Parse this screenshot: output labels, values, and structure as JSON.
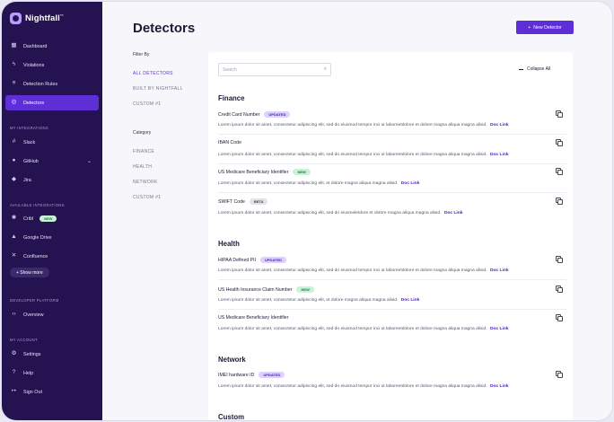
{
  "brand": {
    "name": "Nightfall",
    "tm": "™"
  },
  "sidebar": {
    "primary": [
      {
        "label": "Dashboard",
        "icon": "grid-icon"
      },
      {
        "label": "Violations",
        "icon": "lightning-icon"
      },
      {
        "label": "Detection Rules",
        "icon": "list-icon"
      },
      {
        "label": "Detectors",
        "icon": "detector-icon"
      }
    ],
    "my_integrations_heading": "MY INTEGRATIONS",
    "my_integrations": [
      {
        "label": "Slack",
        "icon": "slack-icon"
      },
      {
        "label": "GitHub",
        "icon": "github-icon"
      },
      {
        "label": "Jira",
        "icon": "jira-icon"
      }
    ],
    "available_heading": "AVAILABLE INTEGRATIONS",
    "available": [
      {
        "label": "Cribl",
        "icon": "cribl-icon",
        "badge": "NEW"
      },
      {
        "label": "Google Drive",
        "icon": "google-drive-icon"
      },
      {
        "label": "Confluence",
        "icon": "confluence-icon"
      }
    ],
    "show_more": "+ Show more",
    "developer_heading": "DEVELOPER PLATFORM",
    "developer": [
      {
        "label": "Overview",
        "icon": "code-icon"
      }
    ],
    "account_heading": "MY ACCOUNT",
    "account": [
      {
        "label": "Settings",
        "icon": "gear-icon"
      },
      {
        "label": "Help",
        "icon": "help-icon"
      },
      {
        "label": "Sign Out",
        "icon": "sign-out-icon"
      }
    ]
  },
  "header": {
    "title": "Detectors",
    "new_button": "New Detector",
    "new_button_icon": "+"
  },
  "filters": {
    "filter_by": "Filter By",
    "filter_items": [
      "ALL DETECTORS",
      "BUILT BY NIGHTFALL",
      "CUSTOM #1"
    ],
    "category_label": "Category",
    "category_items": [
      "FINANCE",
      "HEALTH",
      "NETWORK",
      "CUSTOM #1"
    ]
  },
  "search": {
    "placeholder": "Search"
  },
  "collapse_all": "Collapse All",
  "doc_link": "Doc Link",
  "categories": [
    {
      "title": "Finance",
      "detectors": [
        {
          "name": "Credit Card Number",
          "badge": "UPDATED",
          "desc": "Lorem ipsum dolor sit amet, consectetur adipiscing elit, sed do eiusmod tempor inci ut laboreetdolore et dolore magna aliqua magna alisid."
        },
        {
          "name": "IBAN Code",
          "badge": "",
          "desc": "Lorem ipsum dolor sit amet, consectetur adipiscing elit, sed do eiusmod tempor inci ut laboreetdolore et dolore magna aliqua magna alisid."
        },
        {
          "name": "US Medicare Beneficiary Identifier",
          "badge": "NEW",
          "desc": "Lorem ipsum dolor sit amet, consectetur adipiscing elit, et dolore magna aliqua magna alisid."
        },
        {
          "name": "SWIFT Code",
          "badge": "BETA",
          "desc": "Lorem ipsum dolor sit amet, consectetur adipiscing elit, sed do eiusmeletdore et dolore magna aliqua magna alisid."
        }
      ]
    },
    {
      "title": "Health",
      "detectors": [
        {
          "name": "HIPAA Defined PII",
          "badge": "UPDATED",
          "desc": "Lorem ipsum dolor sit amet, consectetur adipiscing elit, sed do eiusmod tempor inci ut laboreetdolore et dolore magna aliqua magna alisid."
        },
        {
          "name": "US Health Insurance Claim Number",
          "badge": "NEW",
          "desc": "Lorem ipsum dolor sit amet, consectetur adipiscing elit, et dolore magna aliqua magna alisid."
        },
        {
          "name": "US Medicare Beneficiary Identifier",
          "badge": "",
          "desc": "Lorem ipsum dolor sit amet, consectetur adipiscing elit, sed do eiusmod tempor inci ut laboreetdolore et dolore magna aliqua magna alisid."
        }
      ]
    },
    {
      "title": "Network",
      "detectors": [
        {
          "name": "IMEI hardware ID",
          "badge": "UPDATED",
          "desc": "Lorem ipsum dolor sit amet, consectetur adipiscing elit, sed do eiusmod tempor inci ut laboreetdolore et dolore magna aliqua magna alisid."
        }
      ]
    },
    {
      "title": "Custom",
      "detectors": []
    }
  ],
  "colors": {
    "sidebar": "#241350",
    "accent": "#5e2fd6",
    "link": "#4b22b8"
  }
}
